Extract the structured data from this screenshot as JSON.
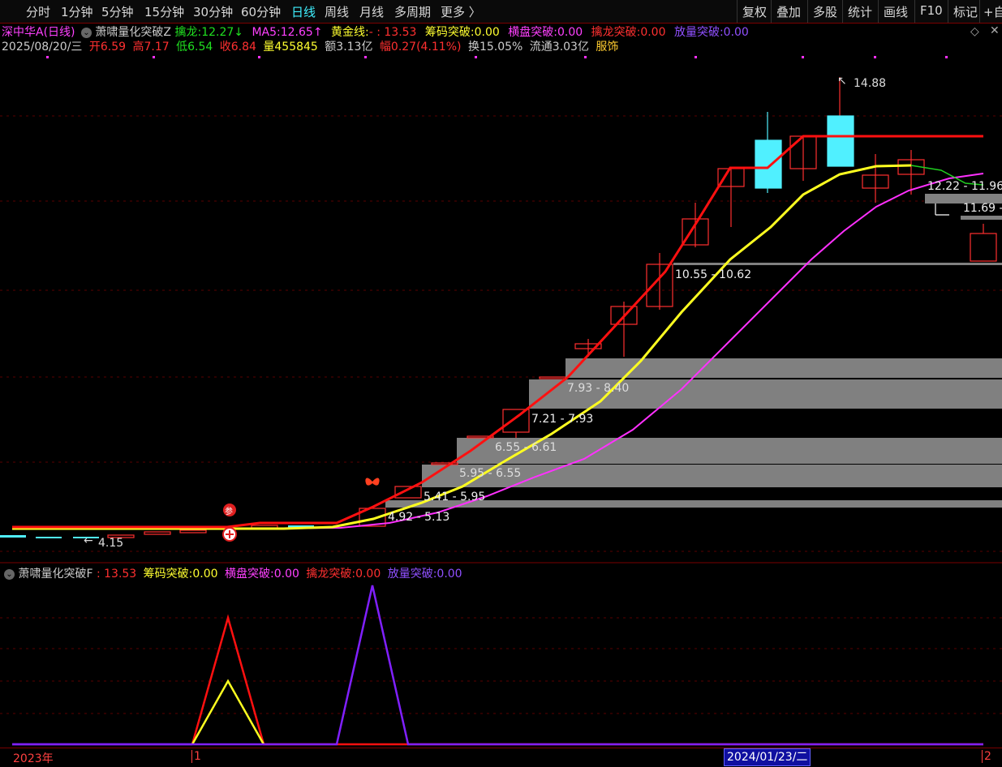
{
  "toolbar": {
    "periods": [
      "分时",
      "1分钟",
      "5分钟",
      "15分钟",
      "30分钟",
      "60分钟",
      "日线",
      "周线",
      "月线",
      "多周期",
      "更多 〉"
    ],
    "active_period": "日线",
    "right_buttons": [
      "复权",
      "叠加",
      "多股",
      "统计",
      "画线",
      "F10",
      "标记",
      "+自"
    ]
  },
  "header": {
    "stock": "深中华A(日线)",
    "indicator": "萧啸量化突破Z",
    "qinlong_label": "擒龙:",
    "qinlong_value": "12.27↓",
    "ma5_label": "MA5:",
    "ma5_value": "12.65↑",
    "gold_label": "黄金线:",
    "gold_value": "- : 13.53",
    "chip_label": "筹码突破:",
    "chip_value": "0.00",
    "hengpan_label": "横盘突破:",
    "hengpan_value": "0.00",
    "qinlongtp_label": "擒龙突破:",
    "qinlongtp_value": "0.00",
    "volume_label": "放量突破:",
    "volume_value": "0.00"
  },
  "quote": {
    "date": "2025/08/20/三",
    "open_label": "开",
    "open": "6.59",
    "high_label": "高",
    "high": "7.17",
    "low_label": "低",
    "low": "6.54",
    "close_label": "收",
    "close": "6.84",
    "vol_label": "量",
    "vol": "455845",
    "amount_label": "额",
    "amount": "3.13亿",
    "range_label": "幅",
    "range": "0.27(4.11%)",
    "turnover_label": "换",
    "turnover": "15.05%",
    "float_label": "流通",
    "float": "3.03亿",
    "sector": "服饰"
  },
  "chart_labels": {
    "high_mark": "14.88",
    "low_mark": "4.15",
    "band_1": "12.22 - 11.96",
    "band_2": "11.69 -",
    "band_3": "10.55 - 10.62",
    "band_4": "7.93 - 8.40",
    "band_5": "7.21 - 7.93",
    "band_6": "6.55 - 6.61",
    "band_7": "5.95 - 6.55",
    "band_8": "5.41 - 5.95",
    "band_9": "4.92 - 5.13"
  },
  "sub_indicator": {
    "name": "萧啸量化突破F",
    "gold_value": ": 13.53",
    "chip_label": "筹码突破:",
    "chip_value": "0.00",
    "hengpan_label": "横盘突破:",
    "hengpan_value": "0.00",
    "qinlongtp_label": "擒龙突破:",
    "qinlongtp_value": "0.00",
    "volume_label": "放量突破:",
    "volume_value": "0.00"
  },
  "bottom": {
    "year": "2023年",
    "mark1": "1",
    "cursor_date": "2024/01/23/二",
    "mark2": "2"
  },
  "colors": {
    "red": "#ff2020",
    "yellow": "#ffff20",
    "magenta": "#ff30ff",
    "cyan": "#50f0ff",
    "green": "#20d020",
    "purple": "#8020ff",
    "gray_band": "#808080"
  }
}
